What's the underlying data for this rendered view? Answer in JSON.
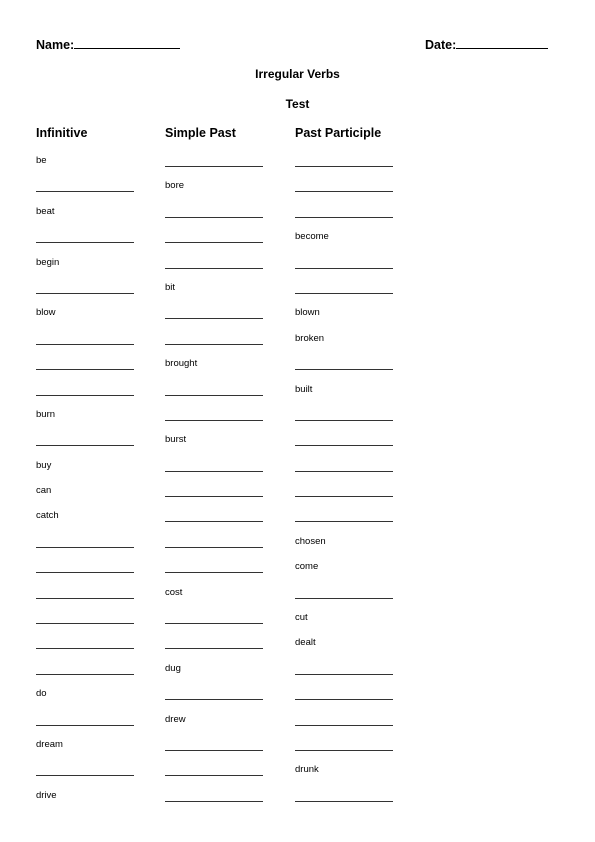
{
  "header": {
    "name_label": "Name:",
    "date_label": "Date:"
  },
  "title": "Irregular Verbs",
  "subtitle": "Test",
  "columns": [
    "Infinitive",
    "Simple Past",
    "Past Participle"
  ],
  "rows": [
    [
      "be",
      "",
      ""
    ],
    [
      "",
      "bore",
      ""
    ],
    [
      "beat",
      "",
      ""
    ],
    [
      "",
      "",
      "become"
    ],
    [
      "begin",
      "",
      ""
    ],
    [
      "",
      "bit",
      ""
    ],
    [
      "blow",
      "",
      "blown"
    ],
    [
      "",
      "",
      "broken"
    ],
    [
      "",
      "brought",
      ""
    ],
    [
      "",
      "",
      "built"
    ],
    [
      "burn",
      "",
      ""
    ],
    [
      "",
      "burst",
      ""
    ],
    [
      "buy",
      "",
      ""
    ],
    [
      "can",
      "",
      ""
    ],
    [
      "catch",
      "",
      ""
    ],
    [
      "",
      "",
      "chosen"
    ],
    [
      "",
      "",
      "come"
    ],
    [
      "",
      "cost",
      ""
    ],
    [
      "",
      "",
      "cut"
    ],
    [
      "",
      "",
      "dealt"
    ],
    [
      "",
      "dug",
      ""
    ],
    [
      "do",
      "",
      ""
    ],
    [
      "",
      "drew",
      ""
    ],
    [
      "dream",
      "",
      ""
    ],
    [
      "",
      "",
      "drunk"
    ],
    [
      "drive",
      "",
      ""
    ]
  ]
}
